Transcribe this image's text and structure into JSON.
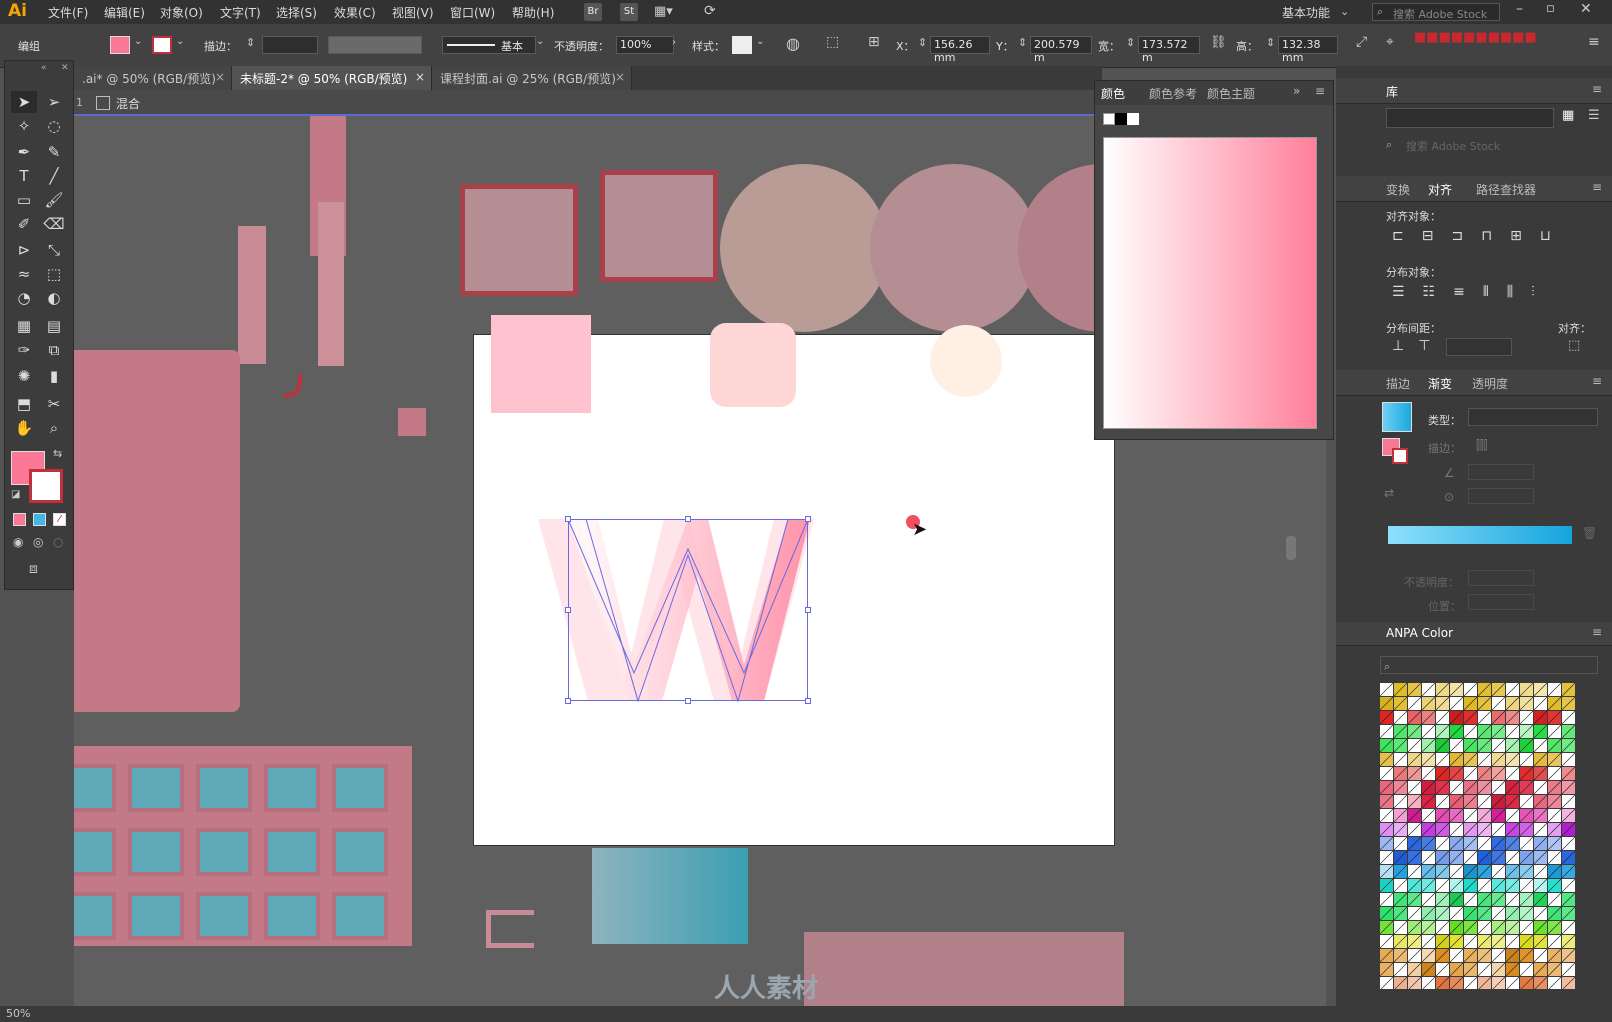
{
  "app": {
    "logo": "Ai"
  },
  "menu": [
    "文件(F)",
    "编辑(E)",
    "对象(O)",
    "文字(T)",
    "选择(S)",
    "效果(C)",
    "视图(V)",
    "窗口(W)",
    "帮助(H)"
  ],
  "menu_right": {
    "workspace": "基本功能",
    "search_placeholder": "搜索 Adobe Stock"
  },
  "control": {
    "mode": "编组",
    "stroke_label": "描边：",
    "stroke_profile": "基本",
    "opacity_label": "不透明度：",
    "opacity_value": "100%",
    "style_label": "样式：",
    "x_label": "X：",
    "x_value": "156.26 mm",
    "y_label": "Y：",
    "y_value": "200.579 m",
    "w_label": "宽：",
    "w_value": "173.572 m",
    "h_label": "高：",
    "h_value": "132.38 mm"
  },
  "tabs": [
    {
      "label": ".ai* @ 50% (RGB/预览)",
      "active": false
    },
    {
      "label": "未标题-2* @ 50% (RGB/预览)",
      "active": true
    },
    {
      "label": "课程封面.ai @ 25% (RGB/预览)",
      "active": false
    }
  ],
  "breadcrumb": {
    "layer": "混合"
  },
  "color_panel": {
    "tabs": [
      "颜色",
      "颜色参考",
      "颜色主题"
    ],
    "gradient_from": "#ffffff",
    "gradient_to": "#ff7f9a"
  },
  "library": {
    "title": "库",
    "search_placeholder": "搜索 Adobe Stock"
  },
  "align": {
    "tabs": [
      "变换",
      "对齐",
      "路径查找器"
    ],
    "align_objects": "对齐对象：",
    "distribute_objects": "分布对象：",
    "distribute_spacing": "分布间距：",
    "align_to": "对齐："
  },
  "gradient_panel": {
    "tabs": [
      "描边",
      "渐变",
      "透明度"
    ],
    "type_label": "类型：",
    "stroke_label": "描边：",
    "opacity_label": "不透明度：",
    "position_label": "位置："
  },
  "anpa": {
    "title": "ANPA Color"
  },
  "status": {
    "zoom": "50%"
  },
  "watermark": "人人素材",
  "colors": {
    "accent_fill": "#fa7896",
    "canvas_pink": "#c47a86",
    "cube_fill": "#b58e94",
    "cube_stroke": "#a8404c",
    "circle_tan": "#b89c95",
    "teal_window": "#5fa9b8",
    "gradient_swatch": "#3fb8e5"
  }
}
